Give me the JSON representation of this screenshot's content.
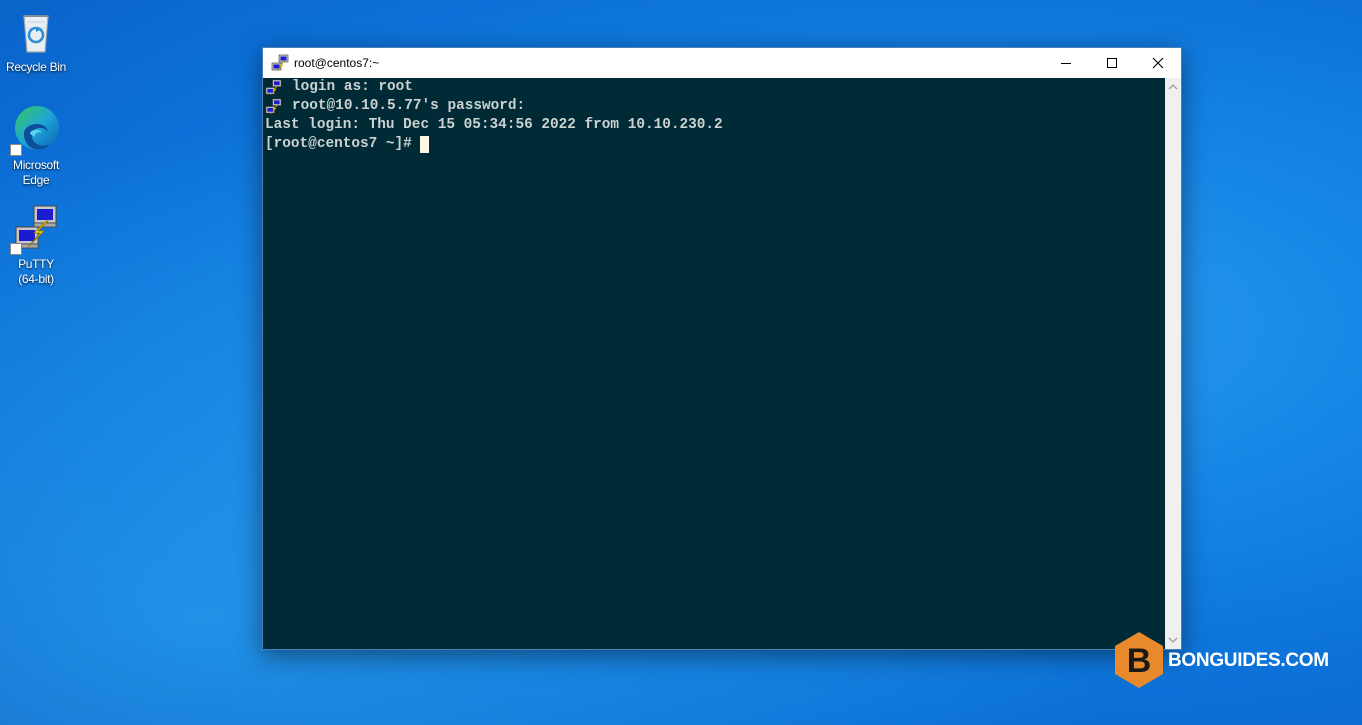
{
  "desktop": {
    "icons": [
      {
        "label": "Recycle Bin",
        "icon": "recycle-bin-icon"
      },
      {
        "label": "Microsoft\nEdge",
        "icon": "edge-icon"
      },
      {
        "label": "PuTTY\n(64-bit)",
        "icon": "putty-icon"
      }
    ]
  },
  "window": {
    "title": "root@centos7:~",
    "controls": [
      "minimize-icon",
      "maximize-icon",
      "close-icon"
    ],
    "colors": {
      "terminal_bg": "#002b36",
      "terminal_fg": "#cbd2d1",
      "cursor": "#fdf6e3"
    }
  },
  "terminal": {
    "lines": [
      {
        "text": "login as: root",
        "icon": "putty-icon"
      },
      {
        "text": "root@10.10.5.77's password:",
        "icon": "putty-icon"
      },
      {
        "text": "Last login: Thu Dec 15 05:34:56 2022 from 10.10.230.2"
      },
      {
        "text": "[root@centos7 ~]#",
        "cursor": true
      }
    ]
  },
  "watermark": {
    "text": "BONGUIDES.COM",
    "letter": "B",
    "color": "#e8892b"
  }
}
